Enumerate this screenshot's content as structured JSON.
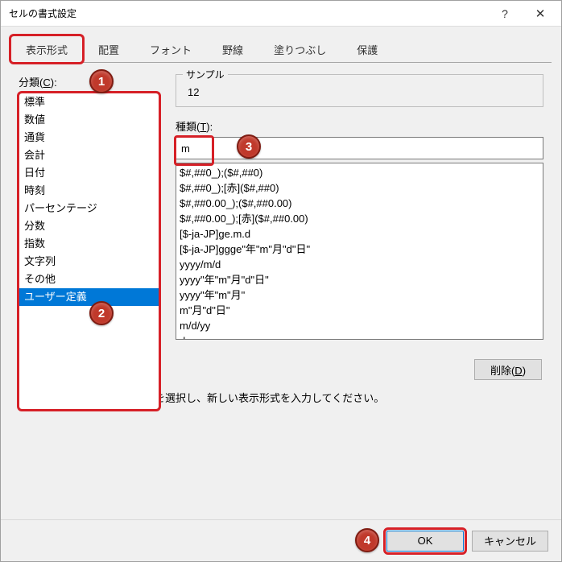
{
  "titlebar": {
    "title": "セルの書式設定"
  },
  "tabs": [
    "表示形式",
    "配置",
    "フォント",
    "野線",
    "塗りつぶし",
    "保護"
  ],
  "active_tab": 0,
  "category": {
    "label": "分類(C):",
    "items": [
      "標準",
      "数値",
      "通貨",
      "会計",
      "日付",
      "時刻",
      "パーセンテージ",
      "分数",
      "指数",
      "文字列",
      "その他",
      "ユーザー定義"
    ],
    "selected_index": 11
  },
  "sample": {
    "label": "サンプル",
    "value": "12"
  },
  "type": {
    "label": "種類(T):",
    "value": "m"
  },
  "format_list": [
    "$#,##0_);($#,##0)",
    "$#,##0_);[赤]($#,##0)",
    "$#,##0.00_);($#,##0.00)",
    "$#,##0.00_);[赤]($#,##0.00)",
    "[$-ja-JP]ge.m.d",
    "[$-ja-JP]ggge\"年\"m\"月\"d\"日\"",
    "yyyy/m/d",
    "yyyy\"年\"m\"月\"d\"日\"",
    "yyyy\"年\"m\"月\"",
    "m\"月\"d\"日\"",
    "m/d/yy",
    "d-mmm-yy"
  ],
  "buttons": {
    "delete": "削除(D)",
    "ok": "OK",
    "cancel": "キャンセル"
  },
  "hint": "基になる組み込みの表示形式を選択し、新しい表示形式を入力してください。",
  "callouts": {
    "c1": "1",
    "c2": "2",
    "c3": "3",
    "c4": "4"
  }
}
